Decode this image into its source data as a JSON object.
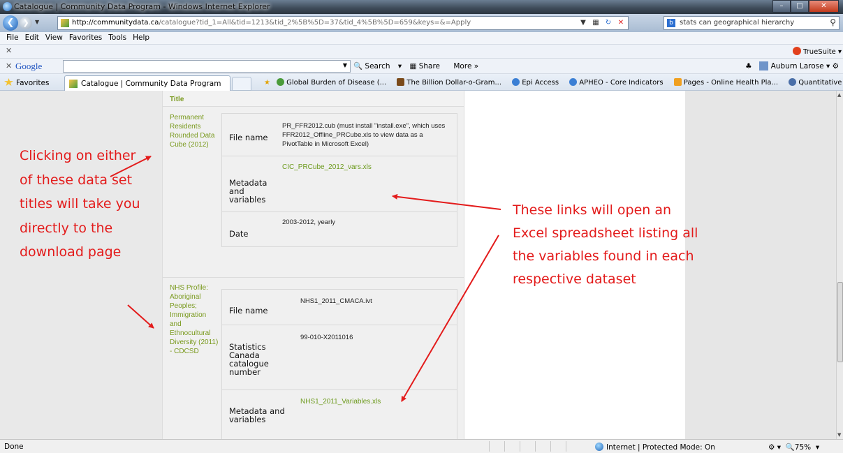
{
  "window": {
    "title": "Catalogue | Community Data Program - Windows Internet Explorer"
  },
  "address": {
    "url_host": "http://communitydata.ca",
    "url_path": "/catalogue?tid_1=All&tid=1213&tid_2%5B%5D=37&tid_4%5B%5D=659&keys=&=Apply",
    "search_text": "stats can geographical hierarchy"
  },
  "menu": [
    "File",
    "Edit",
    "View",
    "Favorites",
    "Tools",
    "Help"
  ],
  "truesuite": {
    "label": "TrueSuite"
  },
  "google": {
    "logo": "Google",
    "search": "Search",
    "share": "Share",
    "more": "More »",
    "user": "Auburn Larose"
  },
  "favorites": {
    "label": "Favorites",
    "tab_title": "Catalogue | Community Data Program",
    "links": [
      "Global Burden of Disease (...",
      "The Billion Dollar-o-Gram...",
      "Epi Access",
      "APHEO - Core Indicators",
      "Pages - Online Health Pla...",
      "Quantitative Tools"
    ]
  },
  "table": {
    "header": "Title",
    "datasets": [
      {
        "title": "Permanent Residents Rounded Data Cube (2012)",
        "fields": {
          "file_label": "File name",
          "file_value": "PR_FFR2012.cub (must install \"install.exe\", which uses FFR2012_Offline_PRCube.xls to view data as a PivotTable in Microsoft Excel)",
          "meta_label": "Metadata and variables",
          "meta_link": "CIC_PRCube_2012_vars.xls",
          "date_label": "Date",
          "date_value": "2003-2012, yearly"
        }
      },
      {
        "title": "NHS Profile: Aboriginal Peoples; Immigration and Ethnocultural Diversity (2011) - CDCSD",
        "fields": {
          "file_label": "File name",
          "file_value": "NHS1_2011_CMACA.ivt",
          "catalogue_label": "Statistics Canada catalogue number",
          "catalogue_value": "99-010-X2011016",
          "meta_label": "Metadata and variables",
          "meta_link": "NHS1_2011_Variables.xls"
        }
      }
    ]
  },
  "annotations": {
    "left": "Clicking on either of these data set titles will take you directly to the download page",
    "right": "These links will open an Excel spreadsheet listing all the variables found in each respective dataset"
  },
  "status": {
    "text": "Done",
    "zone": "Internet | Protected Mode: On",
    "zoom": "75%"
  },
  "colors": {
    "link_green": "#7a9a1e",
    "annotation_red": "#e31b1b"
  }
}
